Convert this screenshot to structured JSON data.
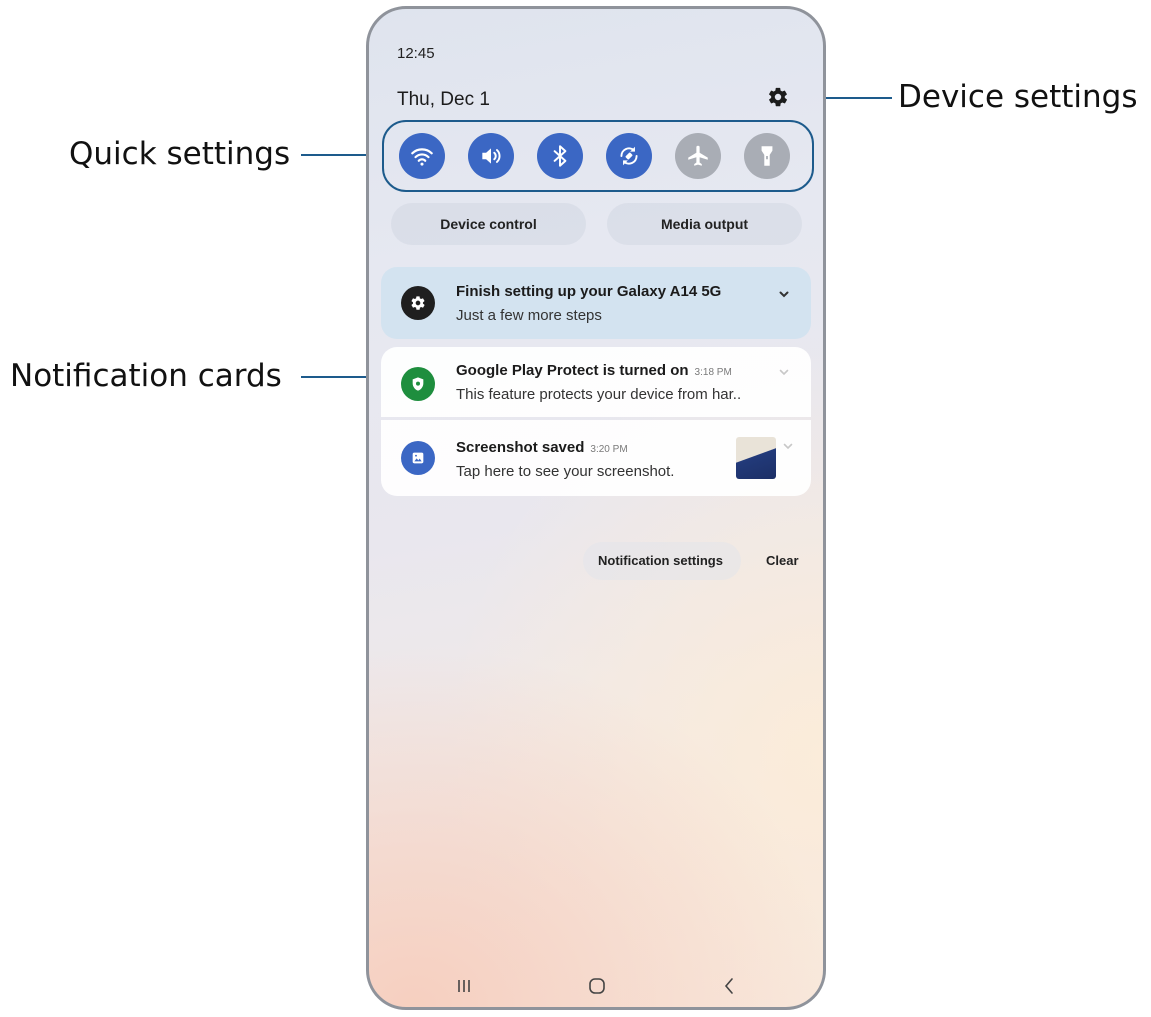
{
  "callouts": {
    "quick_settings": "Quick settings",
    "notification_cards": "Notification cards",
    "device_settings": "Device settings"
  },
  "status_bar": {
    "time": "12:45"
  },
  "header": {
    "date": "Thu, Dec 1",
    "settings_icon": "gear-icon"
  },
  "quick_settings": [
    {
      "name": "wifi",
      "icon": "wifi-icon",
      "state": "on"
    },
    {
      "name": "sound",
      "icon": "volume-icon",
      "state": "on"
    },
    {
      "name": "bluetooth",
      "icon": "bluetooth-icon",
      "state": "on"
    },
    {
      "name": "auto-rotate",
      "icon": "rotate-icon",
      "state": "on"
    },
    {
      "name": "airplane-mode",
      "icon": "airplane-icon",
      "state": "off"
    },
    {
      "name": "flashlight",
      "icon": "flashlight-icon",
      "state": "off"
    }
  ],
  "pills": {
    "device_control": "Device control",
    "media_output": "Media output"
  },
  "notifications": [
    {
      "title": "Finish setting up your Galaxy A14 5G",
      "time": "",
      "body": "Just a few more steps",
      "icon": "gear-icon",
      "icon_color": "#1f1f1f"
    },
    {
      "title": "Google Play Protect is turned on",
      "time": "3:18 PM",
      "body": "This feature protects your device from har..",
      "icon": "shield-icon",
      "icon_color": "#1e8e3e"
    },
    {
      "title": "Screenshot saved",
      "time": "3:20 PM",
      "body": "Tap here to see your screenshot.",
      "icon": "image-icon",
      "icon_color": "#3b67c4"
    }
  ],
  "actions": {
    "notification_settings": "Notification settings",
    "clear": "Clear"
  },
  "nav": {
    "recents": "recents-icon",
    "home": "home-icon",
    "back": "back-icon"
  },
  "colors": {
    "accent": "#3b67c4",
    "callout": "#1d5b8c",
    "tile_off": "#a9adb5"
  }
}
